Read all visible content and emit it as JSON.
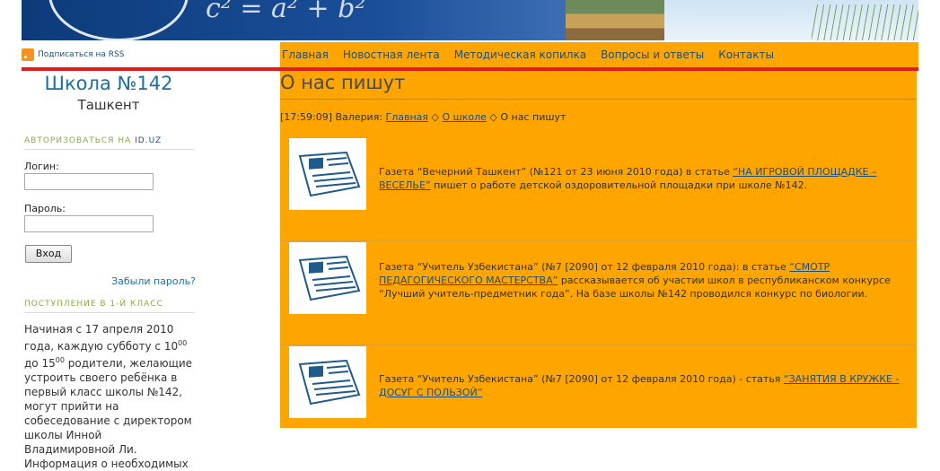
{
  "nav": {
    "items": [
      "Главная",
      "Новостная лента",
      "Методическая копилка",
      "Вопросы и ответы",
      "Контакты"
    ]
  },
  "rss": {
    "label": "Подписаться на RSS"
  },
  "sidebar": {
    "school_name": "Школа №142",
    "city": "Ташкент",
    "auth_heading_prefix": "Авторизоваться на",
    "auth_heading_site": "ID.UZ",
    "login_label": "Логин:",
    "password_label": "Пароль:",
    "login_button": "Вход",
    "forgot_link": "Забыли пароль?",
    "admission_heading": "Поступление в 1-й класс",
    "admission_text_1": "Начиная с 17 апреля 2010 года, каждую субботу с 10",
    "admission_sup_1": "00",
    "admission_text_2": " до 15",
    "admission_sup_2": "00",
    "admission_text_3": " родители, желающие устроить своего ребёнка в первый класс школы №142, могут прийти на собеседование с директором школы Инной Владимировной Ли. Информация о необходимых"
  },
  "main": {
    "title": "О нас пишут",
    "breadcrumb": {
      "prefix": "[17:59:09] Валерия:",
      "home": "Главная",
      "sep": "◇",
      "about": "О школе",
      "current": "О нас пишут"
    },
    "articles": [
      {
        "text_before": "Газета “Вечерний Ташкент” (№121 от 23 июня 2010 года) в статье ",
        "link": "“НА ИГРОВОЙ ПЛОЩАДКЕ – ВЕСЕЛЬЕ”",
        "text_after": " пишет о работе детской оздоровительной площадки при школе №142."
      },
      {
        "text_before": "Газета “Учитель Узбекистана” (№7 [2090] от 12 февраля 2010 года): в статье ",
        "link": "“СМОТР ПЕДАГОГИЧЕСКОГО МАСТЕРСТВА”",
        "text_after": " рассказывается об участии школ в республиканском конкурсе “Лучший учитель-предметник года”. На базе школы №142 проводился конкурс по биологии."
      },
      {
        "text_before": "Газета “Учитель Узбекистана” (№7 [2090] от 12 февраля 2010 года) - статья ",
        "link": "“ЗАНЯТИЯ В КРУЖКЕ - ДОСУГ С ПОЛЬЗОЙ”",
        "text_after": ""
      }
    ]
  },
  "banner": {
    "formula": "c² = a² + b²"
  }
}
